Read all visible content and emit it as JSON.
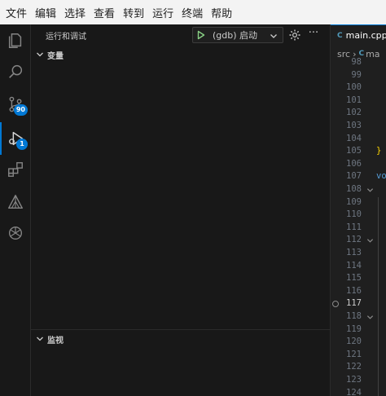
{
  "menubar": {
    "items": [
      "文件",
      "编辑",
      "选择",
      "查看",
      "转到",
      "运行",
      "终端",
      "帮助"
    ]
  },
  "activitybar": {
    "items": [
      {
        "name": "explorer",
        "icon": "files-icon"
      },
      {
        "name": "search",
        "icon": "search-icon"
      },
      {
        "name": "source-control",
        "icon": "source-control-icon",
        "badge": "90"
      },
      {
        "name": "run-and-debug",
        "icon": "run-debug-icon",
        "badge": "1",
        "active": true
      },
      {
        "name": "extensions",
        "icon": "extensions-icon"
      },
      {
        "name": "remote",
        "icon": "triangle-icon"
      },
      {
        "name": "chat",
        "icon": "ai-flower-icon"
      }
    ]
  },
  "sidebar": {
    "title": "运行和调试",
    "launch_config": "(gdb) 启动",
    "more": "···",
    "sections": {
      "variables": "变量",
      "watch": "监视"
    }
  },
  "editor": {
    "tab": {
      "lang": "C",
      "name": "main.cpp"
    },
    "breadcrumbs": {
      "folder": "src",
      "lang": "C",
      "file": "ma"
    },
    "lines": [
      {
        "n": "98"
      },
      {
        "n": "99"
      },
      {
        "n": "100"
      },
      {
        "n": "101"
      },
      {
        "n": "102"
      },
      {
        "n": "103"
      },
      {
        "n": "104"
      },
      {
        "n": "105",
        "code": "}"
      },
      {
        "n": "106"
      },
      {
        "n": "107",
        "code": "vo"
      },
      {
        "n": "108",
        "fold": true
      },
      {
        "n": "109"
      },
      {
        "n": "110"
      },
      {
        "n": "111"
      },
      {
        "n": "112",
        "fold": true
      },
      {
        "n": "113"
      },
      {
        "n": "114"
      },
      {
        "n": "115"
      },
      {
        "n": "116"
      },
      {
        "n": "117",
        "current": true,
        "breakpoint": true
      },
      {
        "n": "118",
        "fold": true
      },
      {
        "n": "119"
      },
      {
        "n": "120"
      },
      {
        "n": "121"
      },
      {
        "n": "122"
      },
      {
        "n": "123"
      },
      {
        "n": "124"
      }
    ]
  },
  "colors": {
    "accent": "#0078d4",
    "run_green": "#89d185",
    "background": "#1f1f1f",
    "sidebar": "#181818",
    "menubar": "#f3f3f3"
  }
}
